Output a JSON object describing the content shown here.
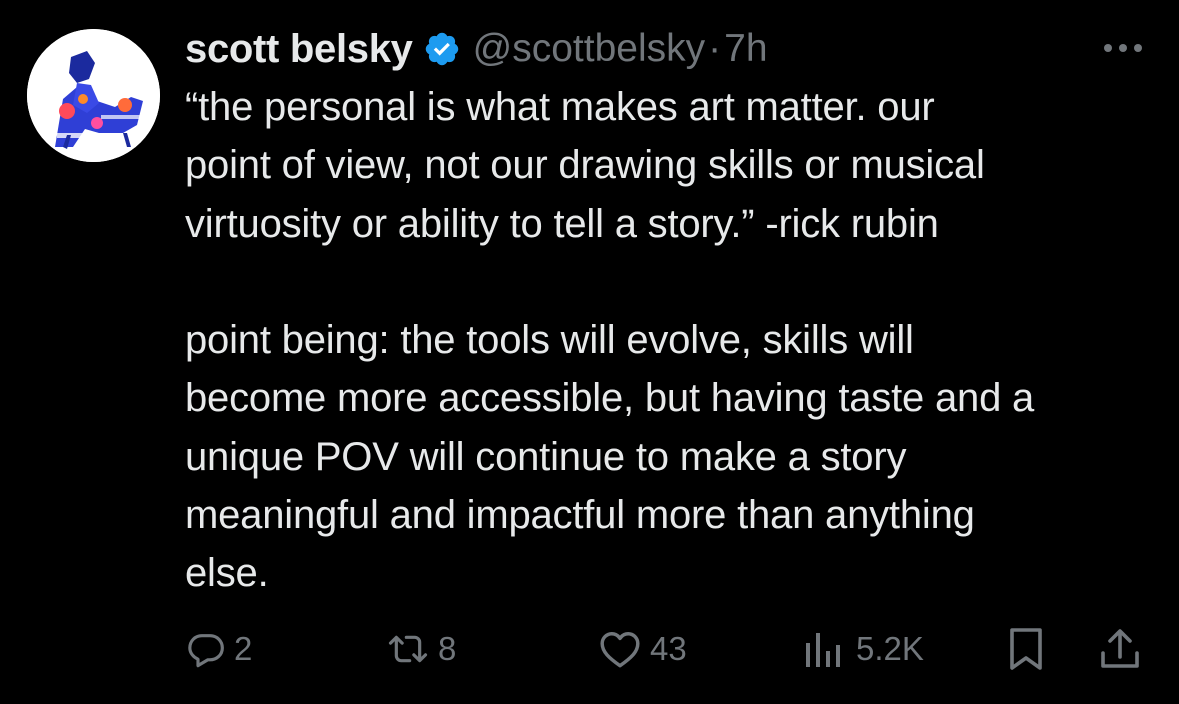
{
  "tweet": {
    "author_name": "scott belsky",
    "handle": "@scottbelsky",
    "separator": "·",
    "time": "7h",
    "verified": true,
    "text": "“the personal is what makes art matter. our\npoint of view, not our drawing skills or musical\nvirtuosity or ability to tell a story.” -rick rubin\n\npoint being: the tools will evolve, skills will\nbecome more accessible, but having taste and a\nunique POV will continue to make a story\nmeaningful and impactful more than anything\nelse."
  },
  "actions": {
    "replies": "2",
    "reposts": "8",
    "likes": "43",
    "views": "5.2K"
  },
  "icons": {
    "avatar": "avatar-image",
    "verified": "verified-badge-icon",
    "more": "more-options-icon",
    "reply": "reply-icon",
    "repost": "repost-icon",
    "like": "heart-icon",
    "views": "views-chart-icon",
    "bookmark": "bookmark-icon",
    "share": "share-icon"
  },
  "colors": {
    "background": "#000000",
    "text_primary": "#e7e9ea",
    "text_secondary": "#71767b",
    "verified_blue": "#1d9bf0"
  }
}
